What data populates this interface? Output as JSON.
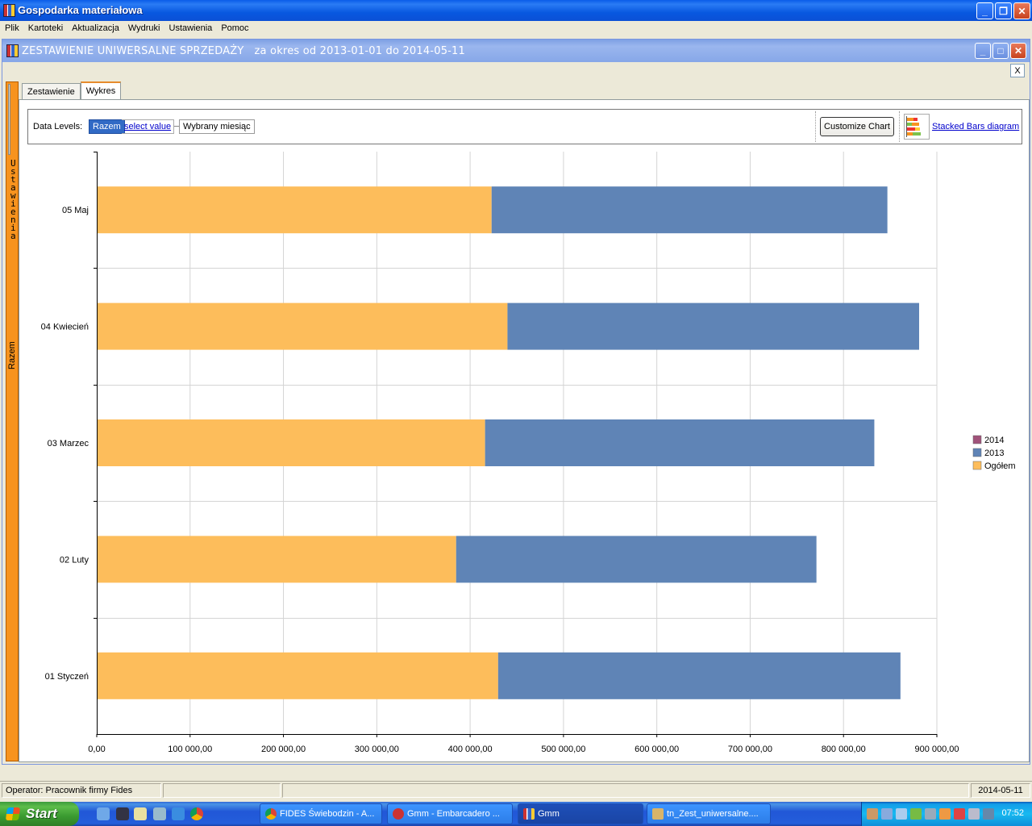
{
  "window": {
    "title": "Gospodarka materiałowa"
  },
  "menu": [
    "Plik",
    "Kartoteki",
    "Aktualizacja",
    "Wydruki",
    "Ustawienia",
    "Pomoc"
  ],
  "child": {
    "title": "ZESTAWIENIE UNIWERSALNE SPRZEDAŻY   za okres od 2013-01-01 do 2014-05-11",
    "close_label": "X"
  },
  "side_panel": {
    "label": "Ustawienia"
  },
  "tabs": [
    {
      "label": "Zestawienie",
      "active": false
    },
    {
      "label": "Wykres",
      "active": true
    }
  ],
  "toolbar": {
    "data_levels_label": "Data Levels:",
    "level_current": "Razem",
    "level_select": "select value",
    "level_next": "Wybrany miesiąc",
    "customize_label": "Customize Chart",
    "diagram_link": "Stacked Bars diagram"
  },
  "chart_data": {
    "type": "bar",
    "orientation": "horizontal",
    "stacked": true,
    "ylabel": "Razem",
    "categories": [
      "05 Maj",
      "04 Kwiecień",
      "03 Marzec",
      "02 Luty",
      "01 Styczeń"
    ],
    "series": [
      {
        "name": "Ogółem",
        "color": "#fdbd5b",
        "values": [
          423000,
          440000,
          416000,
          385000,
          430000
        ]
      },
      {
        "name": "2013",
        "color": "#5f84b6",
        "values": [
          424000,
          441000,
          417000,
          386000,
          431000
        ]
      },
      {
        "name": "2014",
        "color": "#a0527a",
        "values": [
          0,
          0,
          0,
          0,
          0
        ]
      }
    ],
    "legend_order": [
      "2014",
      "2013",
      "Ogółem"
    ],
    "legend_position": "right",
    "xlim": [
      0,
      900000
    ],
    "xticks": [
      0,
      100000,
      200000,
      300000,
      400000,
      500000,
      600000,
      700000,
      800000,
      900000
    ],
    "xtick_labels": [
      "0,00",
      "100 000,00",
      "200 000,00",
      "300 000,00",
      "400 000,00",
      "500 000,00",
      "600 000,00",
      "700 000,00",
      "800 000,00",
      "900 000,00"
    ],
    "grid": true
  },
  "status": {
    "operator": "Operator: Pracownik firmy Fides",
    "date": "2014-05-11"
  },
  "taskbar": {
    "start_label": "Start",
    "tasks": [
      {
        "label": "FIDES Świebodzin - A...",
        "active": false
      },
      {
        "label": "Gmm - Embarcadero ...",
        "active": false
      },
      {
        "label": "Gmm",
        "active": true
      },
      {
        "label": "tn_Zest_uniwersalne....",
        "active": false
      }
    ],
    "clock": "07:52"
  }
}
